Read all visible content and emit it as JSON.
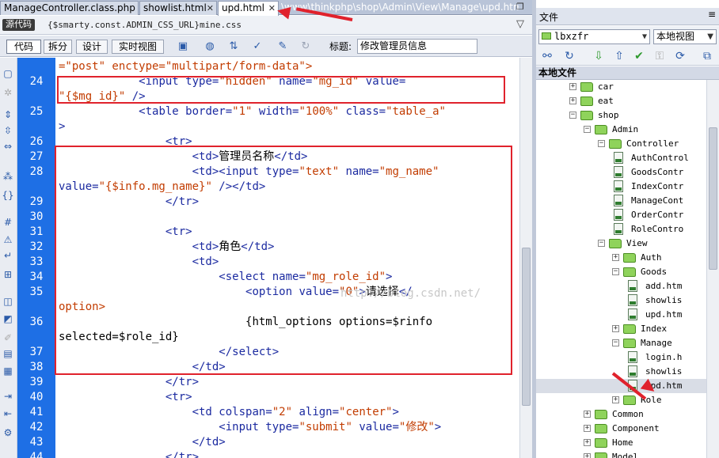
{
  "tabs": [
    {
      "label": "ManageController.class.php"
    },
    {
      "label": "showlist.html"
    },
    {
      "label": "upd.html"
    }
  ],
  "tab_path": "\\www\\thinkphp\\shop\\Admin\\View\\Manage\\upd.html",
  "source": {
    "label": "源代码",
    "file": "{$smarty.const.ADMIN_CSS_URL}mine.css"
  },
  "views": {
    "code": "代码",
    "split": "拆分",
    "design": "设计",
    "live": "实时视图"
  },
  "title_label": "标题:",
  "title_value": "修改管理员信息",
  "line_numbers": [
    "",
    "24",
    "",
    "25",
    "",
    "26",
    "27",
    "28",
    "",
    "29",
    "30",
    "31",
    "32",
    "33",
    "34",
    "35",
    "",
    "36",
    "",
    "37",
    "38",
    "39",
    "40",
    "41",
    "42",
    "43",
    "44"
  ],
  "code_lines": {
    "l0": {
      "a": "=\"post\" enctype=\"multipart/form-data\">"
    },
    "l1": {
      "t1": "<input",
      "a1": " type=",
      "s1": "\"hidden\"",
      "a2": " name=",
      "s2": "\"mg_id\"",
      "a3": " value="
    },
    "l2": {
      "s1": "\"{$mg_id}\"",
      "t1": " />"
    },
    "l3": {
      "t1": "<table",
      "a1": " border=",
      "s1": "\"1\"",
      "a2": " width=",
      "s2": "\"100%\"",
      "a3": " class=",
      "s3": "\"table_a\""
    },
    "l4": {
      "t1": ">"
    },
    "l5": {
      "t1": "<tr>"
    },
    "l6": {
      "t1": "<td>",
      "x1": "管理员名称",
      "t2": "</td>"
    },
    "l7": {
      "t1": "<td>",
      "t2": "<input",
      "a1": " type=",
      "s1": "\"text\"",
      "a2": " name=",
      "s2": "\"mg_name\""
    },
    "l8": {
      "a1": "value=",
      "s1": "\"{$info.mg_name}\"",
      "t1": " />",
      "t2": "</td>"
    },
    "l9": {
      "t1": "</tr>"
    },
    "l11": {
      "t1": "<tr>"
    },
    "l12": {
      "t1": "<td>",
      "x1": "角色",
      "t2": "</td>"
    },
    "l13": {
      "t1": "<td>"
    },
    "l14": {
      "t1": "<select",
      "a1": " name=",
      "s1": "\"mg_role_id\"",
      "t2": ">"
    },
    "l15": {
      "t1": "<option",
      "a1": " value=",
      "s1": "\"0\"",
      "t2": ">",
      "x1": "请选择",
      "t3": "</"
    },
    "l16": {
      "s1": "option>"
    },
    "l17": {
      "x1": "{html_options options=$rinfo"
    },
    "l18": {
      "x1": "selected=$role_id}"
    },
    "l19": {
      "t1": "</select>"
    },
    "l20": {
      "t1": "</td>"
    },
    "l21": {
      "t1": "</tr>"
    },
    "l22": {
      "t1": "<tr>"
    },
    "l23": {
      "t1": "<td",
      "a1": " colspan=",
      "s1": "\"2\"",
      "a2": " align=",
      "s2": "\"center\"",
      "t2": ">"
    },
    "l24": {
      "t1": "<input",
      "a1": " type=",
      "s1": "\"submit\"",
      "a2": " value=",
      "s2": "\"修改\"",
      "t2": ">"
    },
    "l25": {
      "t1": "</td>"
    },
    "l26": {
      "t1": "</tr>"
    }
  },
  "watermark": "http://blog.csdn.net/",
  "panel": {
    "title": "文件",
    "site": "lbxzfr",
    "view": "本地视图",
    "tree_header": "本地文件"
  },
  "tree": [
    {
      "label": "car",
      "depth": 0,
      "type": "folder",
      "expander": "+"
    },
    {
      "label": "eat",
      "depth": 0,
      "type": "folder",
      "expander": "+"
    },
    {
      "label": "shop",
      "depth": 0,
      "type": "folder",
      "expander": "-"
    },
    {
      "label": "Admin",
      "depth": 1,
      "type": "folder",
      "expander": "-"
    },
    {
      "label": "Controller",
      "depth": 2,
      "type": "folder",
      "expander": "-"
    },
    {
      "label": "AuthControl",
      "depth": 3,
      "type": "file"
    },
    {
      "label": "GoodsContr",
      "depth": 3,
      "type": "file"
    },
    {
      "label": "IndexContr",
      "depth": 3,
      "type": "file"
    },
    {
      "label": "ManageCont",
      "depth": 3,
      "type": "file"
    },
    {
      "label": "OrderContr",
      "depth": 3,
      "type": "file"
    },
    {
      "label": "RoleContro",
      "depth": 3,
      "type": "file"
    },
    {
      "label": "View",
      "depth": 2,
      "type": "folder",
      "expander": "-"
    },
    {
      "label": "Auth",
      "depth": 3,
      "type": "folder",
      "expander": "+"
    },
    {
      "label": "Goods",
      "depth": 3,
      "type": "folder",
      "expander": "-"
    },
    {
      "label": "add.htm",
      "depth": 4,
      "type": "file"
    },
    {
      "label": "showlis",
      "depth": 4,
      "type": "file"
    },
    {
      "label": "upd.htm",
      "depth": 4,
      "type": "file"
    },
    {
      "label": "Index",
      "depth": 3,
      "type": "folder",
      "expander": "+"
    },
    {
      "label": "Manage",
      "depth": 3,
      "type": "folder",
      "expander": "-"
    },
    {
      "label": "login.h",
      "depth": 4,
      "type": "file"
    },
    {
      "label": "showlis",
      "depth": 4,
      "type": "file"
    },
    {
      "label": "upd.htm",
      "depth": 4,
      "type": "file",
      "selected": true
    },
    {
      "label": "Role",
      "depth": 3,
      "type": "folder",
      "expander": "+"
    },
    {
      "label": "Common",
      "depth": 1,
      "type": "folder",
      "expander": "+"
    },
    {
      "label": "Component",
      "depth": 1,
      "type": "folder",
      "expander": "+"
    },
    {
      "label": "Home",
      "depth": 1,
      "type": "folder",
      "expander": "+"
    },
    {
      "label": "Model",
      "depth": 1,
      "type": "folder",
      "expander": "+"
    }
  ],
  "colors": {
    "gutter": "#1e6fe5",
    "highlight_box": "#e0222c",
    "tag": "#1b2aa0",
    "string": "#c23c00"
  }
}
